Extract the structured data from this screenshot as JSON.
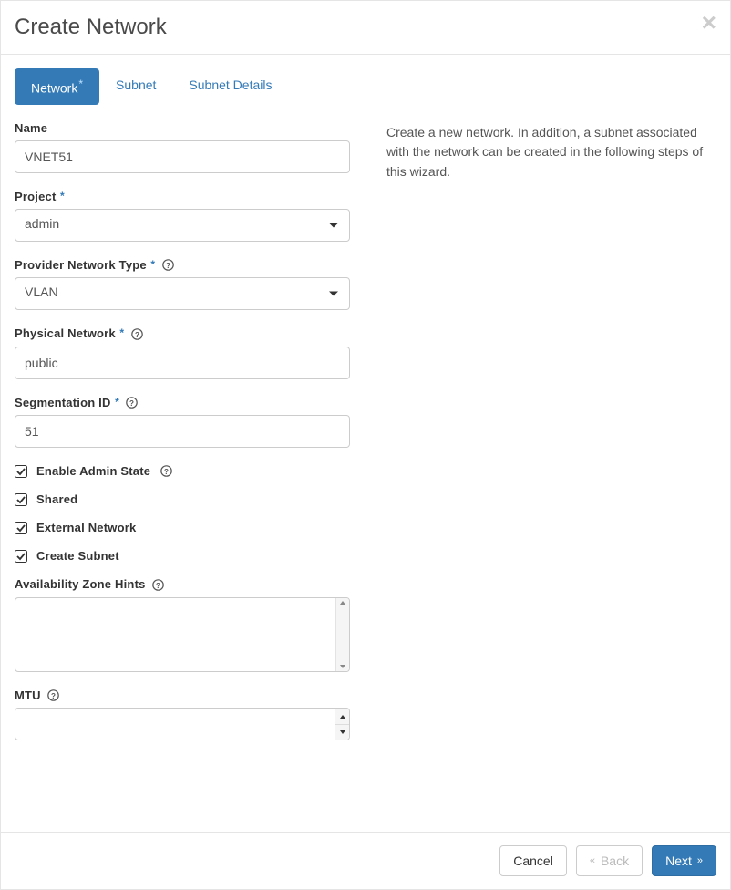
{
  "header": {
    "title": "Create Network"
  },
  "tabs": [
    {
      "label": "Network",
      "required": true,
      "active": true
    },
    {
      "label": "Subnet",
      "required": false,
      "active": false
    },
    {
      "label": "Subnet Details",
      "required": false,
      "active": false
    }
  ],
  "description": "Create a new network. In addition, a subnet associated with the network can be created in the following steps of this wizard.",
  "form": {
    "name": {
      "label": "Name",
      "value": "VNET51"
    },
    "project": {
      "label": "Project",
      "value": "admin"
    },
    "provider_network_type": {
      "label": "Provider Network Type",
      "value": "VLAN"
    },
    "physical_network": {
      "label": "Physical Network",
      "value": "public"
    },
    "segmentation_id": {
      "label": "Segmentation ID",
      "value": "51"
    },
    "enable_admin_state": {
      "label": "Enable Admin State",
      "checked": true
    },
    "shared": {
      "label": "Shared",
      "checked": true
    },
    "external_network": {
      "label": "External Network",
      "checked": true
    },
    "create_subnet": {
      "label": "Create Subnet",
      "checked": true
    },
    "availability_zone_hints": {
      "label": "Availability Zone Hints",
      "value": ""
    },
    "mtu": {
      "label": "MTU",
      "value": ""
    }
  },
  "footer": {
    "cancel": "Cancel",
    "back": "Back",
    "next": "Next"
  }
}
